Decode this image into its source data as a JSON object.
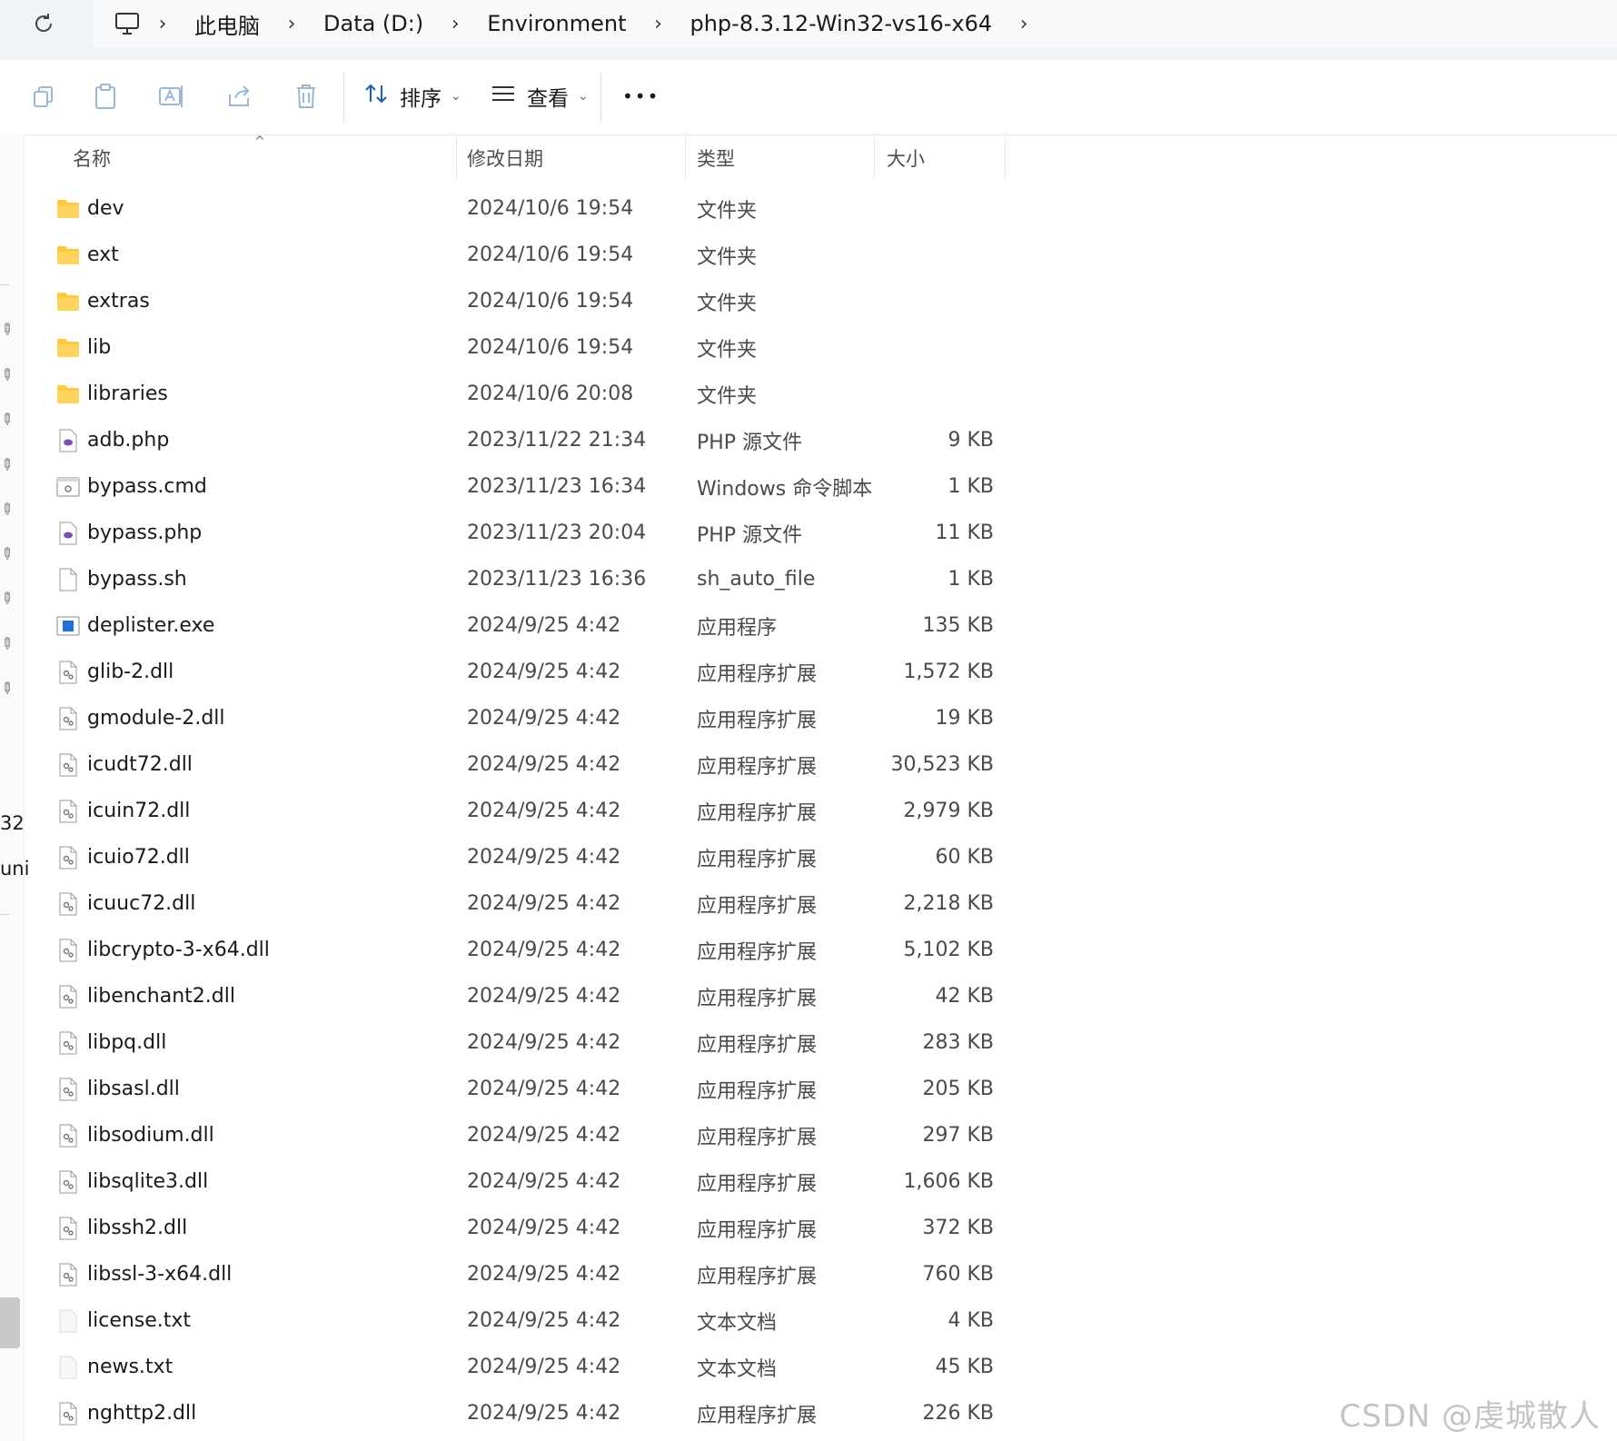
{
  "breadcrumb": {
    "items": [
      "此电脑",
      "Data (D:)",
      "Environment",
      "php-8.3.12-Win32-vs16-x64"
    ]
  },
  "toolbar": {
    "sort_label": "排序",
    "view_label": "查看",
    "more_label": "•••"
  },
  "columns": {
    "name": "名称",
    "date": "修改日期",
    "type": "类型",
    "size": "大小"
  },
  "files": [
    {
      "name": "dev",
      "date": "2024/10/6 19:54",
      "type": "文件夹",
      "size": "",
      "icon": "folder-icon"
    },
    {
      "name": "ext",
      "date": "2024/10/6 19:54",
      "type": "文件夹",
      "size": "",
      "icon": "folder-icon"
    },
    {
      "name": "extras",
      "date": "2024/10/6 19:54",
      "type": "文件夹",
      "size": "",
      "icon": "folder-icon"
    },
    {
      "name": "lib",
      "date": "2024/10/6 19:54",
      "type": "文件夹",
      "size": "",
      "icon": "folder-icon"
    },
    {
      "name": "libraries",
      "date": "2024/10/6 20:08",
      "type": "文件夹",
      "size": "",
      "icon": "folder-icon"
    },
    {
      "name": "adb.php",
      "date": "2023/11/22 21:34",
      "type": "PHP 源文件",
      "size": "9 KB",
      "icon": "php-file-icon"
    },
    {
      "name": "bypass.cmd",
      "date": "2023/11/23 16:34",
      "type": "Windows 命令脚本",
      "size": "1 KB",
      "icon": "cmd-file-icon"
    },
    {
      "name": "bypass.php",
      "date": "2023/11/23 20:04",
      "type": "PHP 源文件",
      "size": "11 KB",
      "icon": "php-file-icon"
    },
    {
      "name": "bypass.sh",
      "date": "2023/11/23 16:36",
      "type": "sh_auto_file",
      "size": "1 KB",
      "icon": "blank-file-icon"
    },
    {
      "name": "deplister.exe",
      "date": "2024/9/25 4:42",
      "type": "应用程序",
      "size": "135 KB",
      "icon": "exe-file-icon"
    },
    {
      "name": "glib-2.dll",
      "date": "2024/9/25 4:42",
      "type": "应用程序扩展",
      "size": "1,572 KB",
      "icon": "dll-file-icon"
    },
    {
      "name": "gmodule-2.dll",
      "date": "2024/9/25 4:42",
      "type": "应用程序扩展",
      "size": "19 KB",
      "icon": "dll-file-icon"
    },
    {
      "name": "icudt72.dll",
      "date": "2024/9/25 4:42",
      "type": "应用程序扩展",
      "size": "30,523 KB",
      "icon": "dll-file-icon"
    },
    {
      "name": "icuin72.dll",
      "date": "2024/9/25 4:42",
      "type": "应用程序扩展",
      "size": "2,979 KB",
      "icon": "dll-file-icon"
    },
    {
      "name": "icuio72.dll",
      "date": "2024/9/25 4:42",
      "type": "应用程序扩展",
      "size": "60 KB",
      "icon": "dll-file-icon"
    },
    {
      "name": "icuuc72.dll",
      "date": "2024/9/25 4:42",
      "type": "应用程序扩展",
      "size": "2,218 KB",
      "icon": "dll-file-icon"
    },
    {
      "name": "libcrypto-3-x64.dll",
      "date": "2024/9/25 4:42",
      "type": "应用程序扩展",
      "size": "5,102 KB",
      "icon": "dll-file-icon"
    },
    {
      "name": "libenchant2.dll",
      "date": "2024/9/25 4:42",
      "type": "应用程序扩展",
      "size": "42 KB",
      "icon": "dll-file-icon"
    },
    {
      "name": "libpq.dll",
      "date": "2024/9/25 4:42",
      "type": "应用程序扩展",
      "size": "283 KB",
      "icon": "dll-file-icon"
    },
    {
      "name": "libsasl.dll",
      "date": "2024/9/25 4:42",
      "type": "应用程序扩展",
      "size": "205 KB",
      "icon": "dll-file-icon"
    },
    {
      "name": "libsodium.dll",
      "date": "2024/9/25 4:42",
      "type": "应用程序扩展",
      "size": "297 KB",
      "icon": "dll-file-icon"
    },
    {
      "name": "libsqlite3.dll",
      "date": "2024/9/25 4:42",
      "type": "应用程序扩展",
      "size": "1,606 KB",
      "icon": "dll-file-icon"
    },
    {
      "name": "libssh2.dll",
      "date": "2024/9/25 4:42",
      "type": "应用程序扩展",
      "size": "372 KB",
      "icon": "dll-file-icon"
    },
    {
      "name": "libssl-3-x64.dll",
      "date": "2024/9/25 4:42",
      "type": "应用程序扩展",
      "size": "760 KB",
      "icon": "dll-file-icon"
    },
    {
      "name": "license.txt",
      "date": "2024/9/25 4:42",
      "type": "文本文档",
      "size": "4 KB",
      "icon": "txt-file-icon"
    },
    {
      "name": "news.txt",
      "date": "2024/9/25 4:42",
      "type": "文本文档",
      "size": "45 KB",
      "icon": "txt-file-icon"
    },
    {
      "name": "nghttp2.dll",
      "date": "2024/9/25 4:42",
      "type": "应用程序扩展",
      "size": "226 KB",
      "icon": "dll-file-icon"
    }
  ],
  "nav_fragments": [
    "32",
    "uni"
  ],
  "watermark": "CSDN @虔城散人",
  "colors": {
    "folder": "#ffc83d",
    "php": "#7b4fb5",
    "exe": "#1e6fd9",
    "address_bg": "#eff4f9"
  }
}
